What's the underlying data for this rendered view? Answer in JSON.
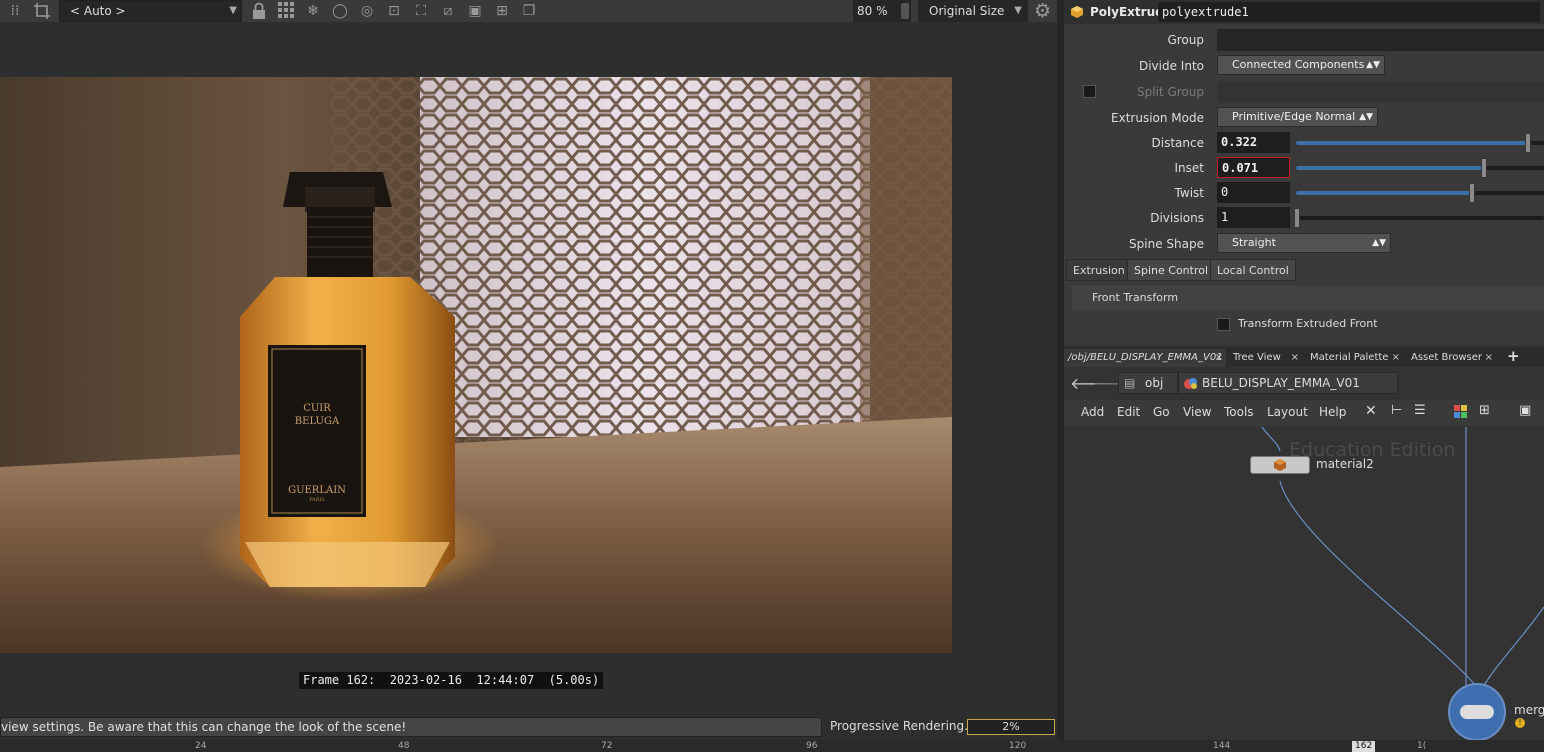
{
  "viewer": {
    "camera_select": "< Auto >",
    "zoom": "80 %",
    "size_select": "Original Size",
    "frame_label": "Frame 162:  2023-02-16  12:44:07  (5.00s)",
    "status_message": "view settings. Be aware that this can change the look of the scene!",
    "progressive_label": "Progressive Rendering...",
    "progress_value": "2%",
    "bottle_label_line1": "CUIR",
    "bottle_label_line2": "BELUGA",
    "bottle_brand": "GUERLAIN",
    "bottle_brand_sub": "PARIS"
  },
  "timeline": {
    "ticks": [
      "24",
      "48",
      "72",
      "96",
      "120",
      "144"
    ],
    "current": "162",
    "end_partial": "1("
  },
  "params": {
    "node_type": "PolyExtrude",
    "node_name": "polyextrude1",
    "group_label": "Group",
    "group_value": "",
    "divide_into_label": "Divide Into",
    "divide_into_value": "Connected Components",
    "split_group_label": "Split Group",
    "extrusion_mode_label": "Extrusion Mode",
    "extrusion_mode_value": "Primitive/Edge Normal",
    "distance_label": "Distance",
    "distance_value": "0.322",
    "inset_label": "Inset",
    "inset_value": "0.071",
    "twist_label": "Twist",
    "twist_value": "0",
    "divisions_label": "Divisions",
    "divisions_value": "1",
    "spine_shape_label": "Spine Shape",
    "spine_shape_value": "Straight",
    "tabs": [
      "Extrusion",
      "Spine Control",
      "Local Control"
    ],
    "section_title": "Front Transform",
    "transform_front_label": "Transform Extruded Front"
  },
  "network": {
    "tabs": [
      "/obj/BELU_DISPLAY_EMMA_V01",
      "Tree View",
      "Material Palette",
      "Asset Browser"
    ],
    "path_root": "obj",
    "path_current": "BELU_DISPLAY_EMMA_V01",
    "menu": [
      "Add",
      "Edit",
      "Go",
      "View",
      "Tools",
      "Layout",
      "Help"
    ],
    "watermark": "Education Edition",
    "node_material": "material2",
    "node_merge": "merge"
  },
  "colors": {
    "accent_blue": "#3d6fa8",
    "progress_border": "#cda64a",
    "wire": "#6b8fc4"
  }
}
